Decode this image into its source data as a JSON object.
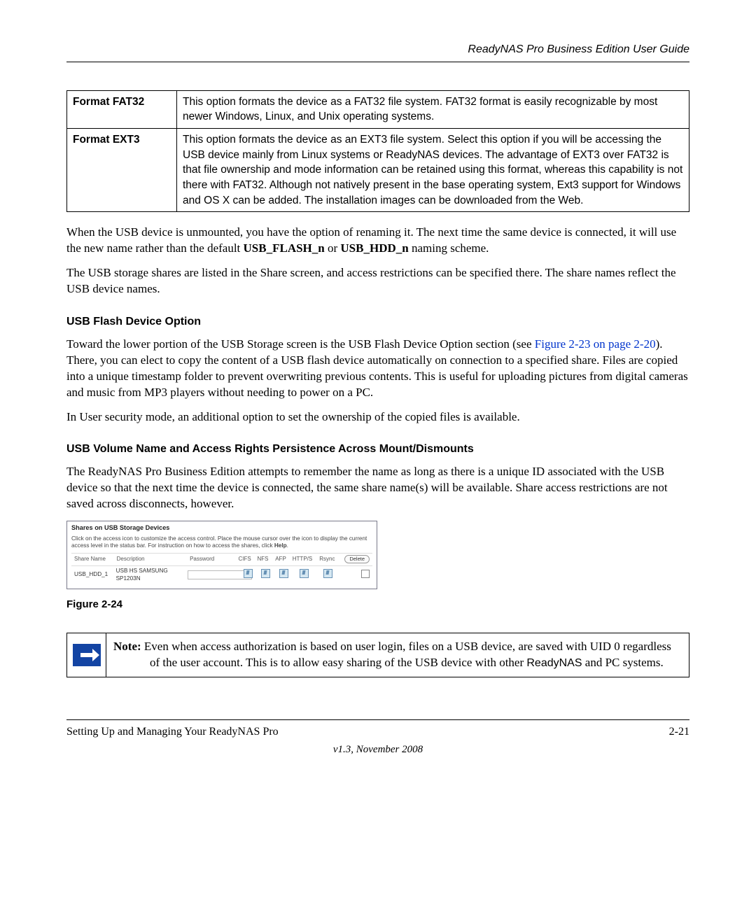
{
  "header": {
    "title": "ReadyNAS Pro Business Edition User Guide"
  },
  "format_table": {
    "rows": [
      {
        "label": "Format FAT32",
        "desc": "This option formats the device as a FAT32 file system. FAT32 format is easily recognizable by most newer Windows, Linux, and Unix operating systems."
      },
      {
        "label": "Format EXT3",
        "desc": "This option formats the device as an EXT3 file system. Select this option if you will be accessing the USB device mainly from Linux systems or ReadyNAS devices. The advantage of EXT3 over FAT32 is that file ownership and mode information can be retained using this format, whereas this capability is not there with FAT32. Although not natively present in the base operating system, Ext3 support for Windows and OS X can be added. The installation images can be downloaded from the Web."
      }
    ]
  },
  "paragraphs": {
    "unmount": {
      "pre": "When the USB device is unmounted, you have the option of renaming it. The next time the same device is connected, it will use the new name rather than the default ",
      "b1": "USB_FLASH_n",
      "mid": " or ",
      "b2": "USB_HDD_n",
      "post": " naming scheme."
    },
    "shares": "The USB storage shares are listed in the Share screen, and access restrictions can be specified there. The share names reflect the USB device names.",
    "flash_heading": "USB Flash Device Option",
    "flash_p1_pre": "Toward the lower portion of the USB Storage screen is the USB Flash Device Option section (see ",
    "flash_link": "Figure 2-23 on page 2-20",
    "flash_p1_post": "). There, you can elect to copy the content of a USB flash device automatically on connection to a specified share. Files are copied into a unique timestamp folder to prevent overwriting previous contents. This is useful for uploading pictures from digital cameras and music from MP3 players without needing to power on a PC.",
    "flash_p2": "In User security mode, an additional option to set the ownership of the copied files is available.",
    "persist_heading": "USB Volume Name and Access Rights Persistence Across Mount/Dismounts",
    "persist_p": "The ReadyNAS Pro Business Edition attempts to remember the name as long as there is a unique ID associated with the USB device so that the next time the device is connected, the same share name(s) will be available. Share access restrictions are not saved across disconnects, however."
  },
  "shares_panel": {
    "title": "Shares on USB Storage Devices",
    "instruction_pre": "Click on the access icon to customize the access control. Place the mouse cursor over the icon to display the current access level in the status bar. For instruction on how to access the shares, click ",
    "instruction_bold": "Help",
    "instruction_post": ".",
    "headers": {
      "sharename": "Share Name",
      "description": "Description",
      "password": "Password",
      "cifs": "CIFS",
      "nfs": "NFS",
      "afp": "AFP",
      "https": "HTTP/S",
      "rsync": "Rsync",
      "delete": "Delete"
    },
    "row": {
      "sharename": "USB_HDD_1",
      "description": "USB HS SAMSUNG SP1203N"
    }
  },
  "figure_caption": "Figure 2-24",
  "note": {
    "label": "Note:",
    "text_pre": " Even when access authorization is based on user login, files on a USB device, are saved with UID 0 regardless of the user account. This is to allow easy sharing of the USB device with other ",
    "sans": "ReadyNAS",
    "text_post": " and PC systems."
  },
  "footer": {
    "left": "Setting Up and Managing Your ReadyNAS Pro",
    "right": "2-21",
    "version": "v1.3, November 2008"
  }
}
